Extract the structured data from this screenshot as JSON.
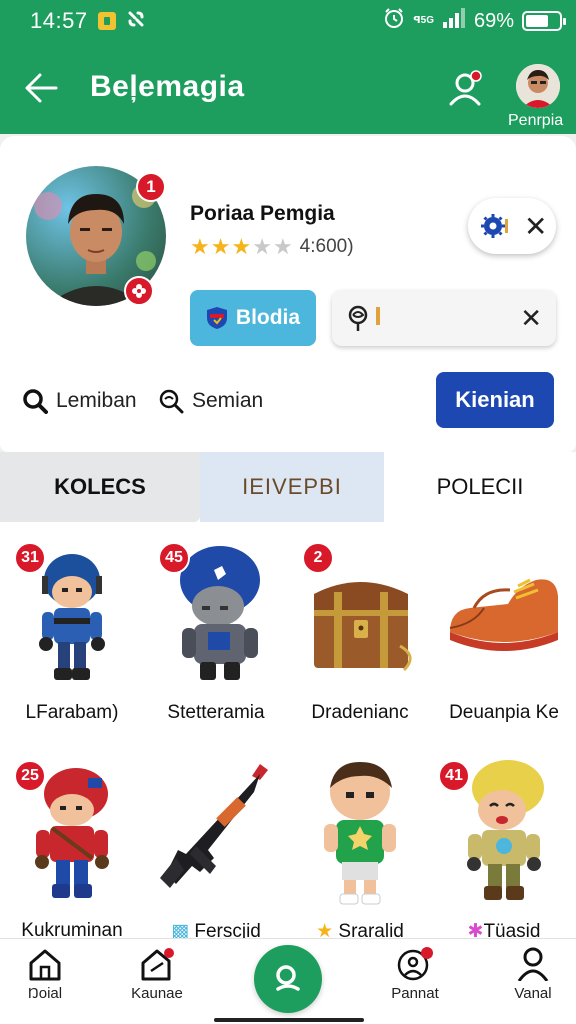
{
  "status_bar": {
    "time": "14:57",
    "network_label": "ꟼ5G",
    "battery_percent": "69%",
    "battery_level": 0.69,
    "icons": [
      "sim-icon",
      "link-icon",
      "alarm-icon",
      "signal-icon",
      "battery-icon"
    ]
  },
  "header": {
    "title": "Beļemagia",
    "avatar_label": "Penrpia",
    "icons": [
      "back-arrow-icon",
      "person-add-icon"
    ]
  },
  "profile": {
    "name": "Poriaa Pemgia",
    "rating_value": 3,
    "rating_max": 5,
    "rating_text": "4:600)",
    "avatar_badge_count": "1",
    "badge_button_label": "Blodia",
    "stats": [
      {
        "label": "Lemiban",
        "icon": "search-icon"
      },
      {
        "label": "Semian",
        "icon": "search-icon"
      }
    ],
    "primary_button_label": "Kienian",
    "colors": {
      "badge_button": "#4cb6dc",
      "primary_button": "#1d48b2",
      "accent": "#1e9e5e",
      "badge_red": "#d7192a"
    }
  },
  "tabs": [
    {
      "label": "KOLECS",
      "active": false
    },
    {
      "label": "IEIVEPBI",
      "active": false
    },
    {
      "label": "POLECII",
      "active": true
    }
  ],
  "items": [
    {
      "label": "LFarabam)",
      "badge": "31",
      "icon": "soldier-figure-icon"
    },
    {
      "label": "Stetteramia",
      "badge": "45",
      "icon": "helmet-figure-icon"
    },
    {
      "label": "Dradenianc",
      "badge": "2",
      "icon": "treasure-chest-icon"
    },
    {
      "label": "Deuanpia Ke",
      "badge": "",
      "icon": "shoe-icon"
    },
    {
      "label": "Kukruminan",
      "badge": "25",
      "icon": "red-soldier-figure-icon"
    },
    {
      "label": "Ferscjid",
      "badge": "",
      "icon": "rifle-icon"
    },
    {
      "label": "Sraralid",
      "badge": "",
      "icon": "boy-figure-icon"
    },
    {
      "label": "Tüasid",
      "badge": "41",
      "icon": "yellow-helmet-figure-icon"
    }
  ],
  "bottom_nav": [
    {
      "label": "Ŋoial",
      "icon": "home-icon"
    },
    {
      "label": "Kaunae",
      "icon": "home-notify-icon"
    },
    {
      "label": "",
      "icon": "search-fab-icon"
    },
    {
      "label": "Pannat",
      "icon": "profile-badge-icon"
    },
    {
      "label": "Vanal",
      "icon": "person-icon"
    }
  ]
}
